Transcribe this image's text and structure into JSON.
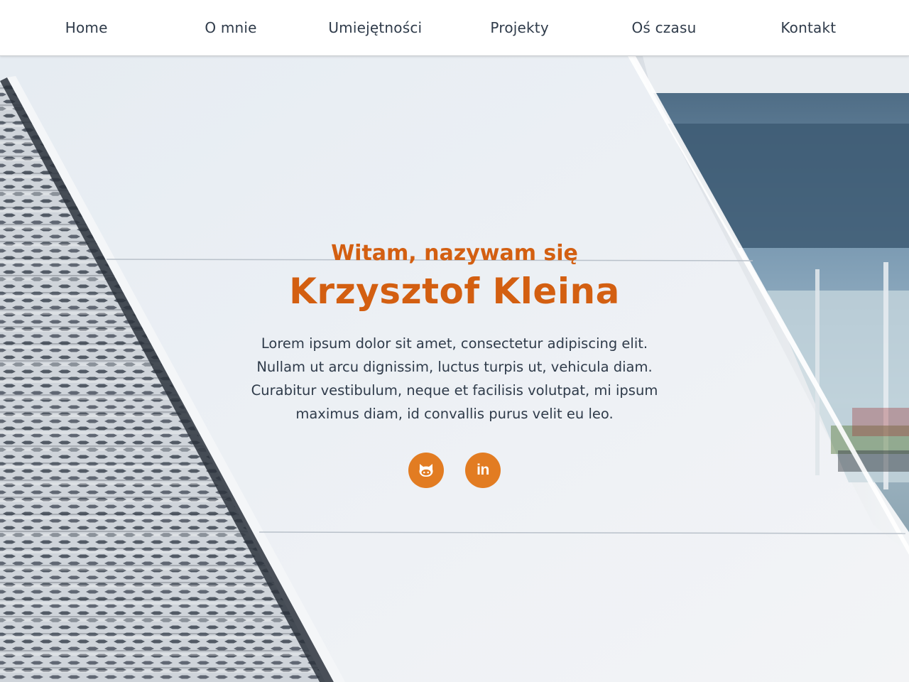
{
  "nav": {
    "items": [
      {
        "label": "Home"
      },
      {
        "label": "O mnie"
      },
      {
        "label": "Umiejętności"
      },
      {
        "label": "Projekty"
      },
      {
        "label": "Oś czasu"
      },
      {
        "label": "Kontakt"
      }
    ]
  },
  "hero": {
    "greeting": "Witam, nazywam się",
    "name": "Krzysztof Kleina",
    "description": "Lorem ipsum dolor sit amet, consectetur adipiscing elit. Nullam ut arcu dignissim, luctus turpis ut, vehicula diam. Curabitur vestibulum, neque et facilisis volutpat, mi ipsum maximus diam, id convallis purus velit eu leo.",
    "socials": [
      {
        "icon": "github-icon"
      },
      {
        "icon": "linkedin-icon",
        "glyph": "in"
      }
    ]
  },
  "colors": {
    "accent": "#d35f11",
    "button": "#e27c22",
    "text": "#2f3b4a",
    "nav_border": "#c9ccd0"
  }
}
